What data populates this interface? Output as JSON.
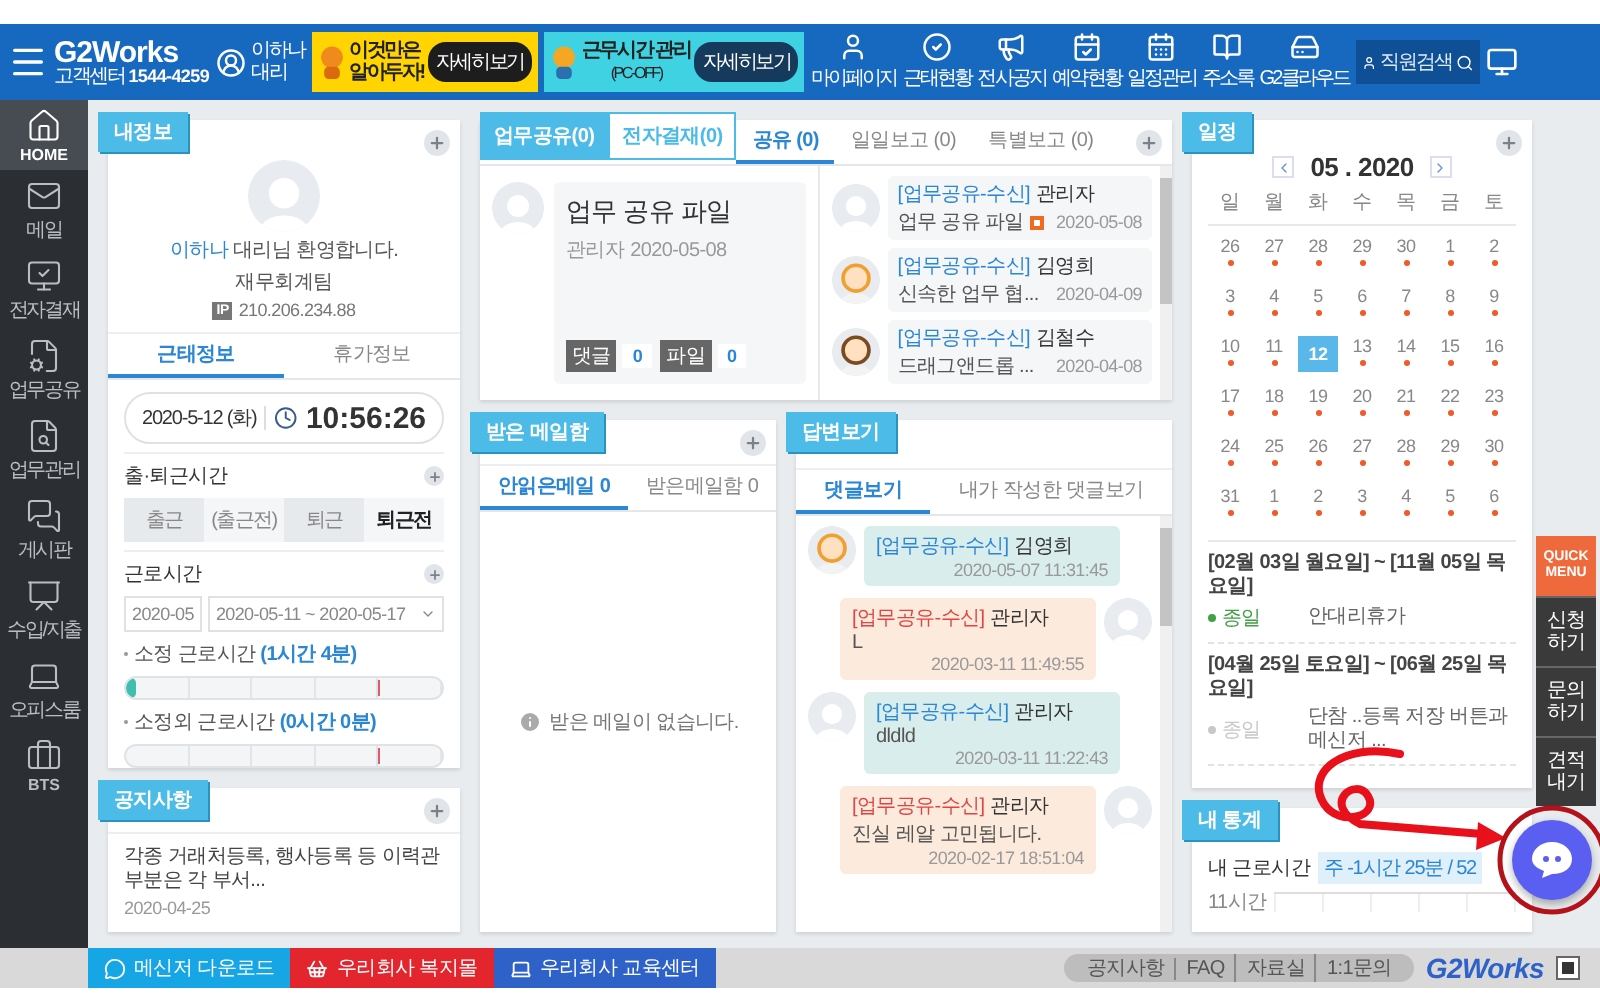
{
  "top_bar": {
    "logo": "G2Works",
    "support_label": "고객센터",
    "support_phone": "1544-4259",
    "user": "이하나 대리",
    "banners": [
      {
        "kind": "tip",
        "text": "이것만은 알아두자!",
        "button": "자세히보기"
      },
      {
        "kind": "pcoff",
        "text": "근무시간 관리",
        "subtext": "(PC-OFF)",
        "button": "자세히보기"
      }
    ],
    "nav": [
      "마이페이지",
      "근태현황",
      "전사공지",
      "예약현황",
      "일정관리",
      "주소록",
      "G2클라우드"
    ],
    "search": {
      "placeholder": "직원검색"
    }
  },
  "sidebar": {
    "items": [
      {
        "label": "HOME",
        "selected": true
      },
      {
        "label": "메일",
        "selected": false
      },
      {
        "label": "전자결재",
        "selected": false
      },
      {
        "label": "업무공유",
        "selected": false
      },
      {
        "label": "업무관리",
        "selected": false
      },
      {
        "label": "게시판",
        "selected": false
      },
      {
        "label": "수입/지출",
        "selected": false
      },
      {
        "label": "오피스룸",
        "selected": false
      },
      {
        "label": "BTS",
        "selected": false
      }
    ]
  },
  "my_info": {
    "title": "내정보",
    "greeting": "**이하나** 대리님 환영합니다.",
    "department": "재무회계팀",
    "ip_label": "IP",
    "ip": "210.206.234.88",
    "tabs": [
      {
        "label": "근태정보",
        "selected": true
      },
      {
        "label": "휴가정보",
        "selected": false
      }
    ],
    "date": "2020-5-12 (화)",
    "time": "10:56:26",
    "commute": {
      "title": "출·퇴근시간",
      "cells": [
        {
          "label": "출근",
          "kind": "label"
        },
        {
          "label": "(출근전)",
          "kind": "value"
        },
        {
          "label": "퇴근",
          "kind": "label"
        },
        {
          "label": "퇴근전",
          "kind": "strong"
        }
      ]
    },
    "work_time": {
      "title": "근로시간",
      "month": "2020-05",
      "week": "2020-05-11 ~ 2020-05-17",
      "bars": [
        {
          "label": "소정 근로시간 **(1시간 4분)**",
          "level": 0.03
        },
        {
          "label": "소정외 근로시간 **(0시간 0분)**"
        }
      ]
    }
  },
  "notice": {
    "title": "공지사항",
    "items": [
      {
        "text": "각종 거래처등록, 행사등록 등 이력관부분은 각 부서...",
        "date": "2020-04-25"
      }
    ]
  },
  "work_share": {
    "tabs": [
      {
        "label": "업무공유(0)",
        "selected": true
      },
      {
        "label": "전자결재(0)",
        "selected": false
      }
    ],
    "subtabs": [
      {
        "label": "공유 (0)",
        "selected": true
      },
      {
        "label": "일일보고 (0)",
        "selected": false
      },
      {
        "label": "특별보고 (0)",
        "selected": false
      }
    ],
    "featured": {
      "title": "업무 공유 파일",
      "author": "관리자",
      "date": "2020-05-08",
      "counts": [
        {
          "label": "댓글",
          "value": "0"
        },
        {
          "label": "파일",
          "value": "0"
        }
      ]
    },
    "feed": [
      {
        "tag": "[업무공유-수신]",
        "name": "관리자",
        "text": "업무 공유 파일",
        "new": true,
        "date": "2020-05-08",
        "avatar": {
          "kind": "blank"
        }
      },
      {
        "tag": "[업무공유-수신]",
        "name": "김영희",
        "text": "신속한 업무 협...",
        "new": false,
        "date": "2020-04-09",
        "avatar": {
          "kind": "girl"
        }
      },
      {
        "tag": "[업무공유-수신]",
        "name": "김철수",
        "text": "드래그앤드롭 ...",
        "new": false,
        "date": "2020-04-08",
        "avatar": {
          "kind": "boy"
        }
      }
    ]
  },
  "mail": {
    "title": "받은 메일함",
    "tabs": [
      {
        "label": "안읽은메일 0",
        "selected": true
      },
      {
        "label": "받은메일함 0",
        "selected": false
      }
    ],
    "empty": "받은 메일이 없습니다."
  },
  "replies": {
    "title": "답변보기",
    "tabs": [
      {
        "label": "댓글보기",
        "selected": true
      },
      {
        "label": "내가 작성한 댓글보기",
        "selected": false
      }
    ],
    "items": [
      {
        "kind": "left",
        "tag": "[업무공유-수신]",
        "name": "김영희",
        "date": "2020-05-07 11:31:45",
        "avatar": {
          "kind": "girl"
        }
      },
      {
        "kind": "right",
        "tag": "[업무공유-수신]",
        "name": "관리자",
        "text": "L",
        "date": "2020-03-11 11:49:55",
        "avatar": {
          "kind": "blank"
        }
      },
      {
        "kind": "left",
        "tag": "[업무공유-수신]",
        "name": "관리자",
        "text": "dldld",
        "date": "2020-03-11 11:22:43",
        "avatar": {
          "kind": "blank"
        }
      },
      {
        "kind": "right",
        "tag": "[업무공유-수신]",
        "name": "관리자",
        "text": "진실 레알 고민됩니다.",
        "date": "2020-02-17 18:51:04",
        "avatar": {
          "kind": "blank"
        }
      }
    ]
  },
  "schedule": {
    "title": "일정",
    "month": "05 . 2020",
    "weekdays": [
      "일",
      "월",
      "화",
      "수",
      "목",
      "금",
      "토"
    ],
    "weeks": [
      [
        {
          "day": "26",
          "selected": false,
          "event": true
        },
        {
          "day": "27",
          "selected": false,
          "event": true
        },
        {
          "day": "28",
          "selected": false,
          "event": true
        },
        {
          "day": "29",
          "selected": false,
          "event": true
        },
        {
          "day": "30",
          "selected": false,
          "event": true
        },
        {
          "day": "1",
          "selected": false,
          "event": true
        },
        {
          "day": "2",
          "selected": false,
          "event": true
        }
      ],
      [
        {
          "day": "3",
          "selected": false,
          "event": true
        },
        {
          "day": "4",
          "selected": false,
          "event": true
        },
        {
          "day": "5",
          "selected": false,
          "event": true
        },
        {
          "day": "6",
          "selected": false,
          "event": true
        },
        {
          "day": "7",
          "selected": false,
          "event": true
        },
        {
          "day": "8",
          "selected": false,
          "event": true
        },
        {
          "day": "9",
          "selected": false,
          "event": true
        }
      ],
      [
        {
          "day": "10",
          "selected": false,
          "event": true
        },
        {
          "day": "11",
          "selected": false,
          "event": true
        },
        {
          "day": "12",
          "selected": true,
          "event": false
        },
        {
          "day": "13",
          "selected": false,
          "event": true
        },
        {
          "day": "14",
          "selected": false,
          "event": true
        },
        {
          "day": "15",
          "selected": false,
          "event": true
        },
        {
          "day": "16",
          "selected": false,
          "event": true
        }
      ],
      [
        {
          "day": "17",
          "selected": false,
          "event": true
        },
        {
          "day": "18",
          "selected": false,
          "event": true
        },
        {
          "day": "19",
          "selected": false,
          "event": true
        },
        {
          "day": "20",
          "selected": false,
          "event": true
        },
        {
          "day": "21",
          "selected": false,
          "event": true
        },
        {
          "day": "22",
          "selected": false,
          "event": true
        },
        {
          "day": "23",
          "selected": false,
          "event": true
        }
      ],
      [
        {
          "day": "24",
          "selected": false,
          "event": true
        },
        {
          "day": "25",
          "selected": false,
          "event": true
        },
        {
          "day": "26",
          "selected": false,
          "event": true
        },
        {
          "day": "27",
          "selected": false,
          "event": true
        },
        {
          "day": "28",
          "selected": false,
          "event": true
        },
        {
          "day": "29",
          "selected": false,
          "event": true
        },
        {
          "day": "30",
          "selected": false,
          "event": true
        }
      ],
      [
        {
          "day": "31",
          "selected": false,
          "event": true
        },
        {
          "day": "1",
          "selected": false,
          "event": true
        },
        {
          "day": "2",
          "selected": false,
          "event": true
        },
        {
          "day": "3",
          "selected": false,
          "event": true
        },
        {
          "day": "4",
          "selected": false,
          "event": true
        },
        {
          "day": "5",
          "selected": false,
          "event": true
        },
        {
          "day": "6",
          "selected": false,
          "event": true
        }
      ]
    ],
    "events": [
      {
        "range": "[02월 03일 월요일] ~ [11월 05일 목요일]",
        "tag": "종일",
        "title": "안대리휴가",
        "color": "#43a047"
      },
      {
        "range": "[04월 25일 토요일] ~ [06월 25일 목요일]",
        "tag": "종일",
        "title": "단참 ..등록 저장 버튼과 메신저 ...",
        "color": "#c8c8c8"
      }
    ]
  },
  "stats": {
    "title": "내 통계",
    "label": "내 근로시간",
    "value": "주 -1시간 25분 / 52",
    "axis_label": "11시간"
  },
  "quick_menu": {
    "title": "QUICK MENU",
    "items": [
      "신청하기",
      "문의하기",
      "견적내기"
    ]
  },
  "bottom_bar": {
    "buttons": [
      {
        "label": "메신저 다운로드",
        "color": "#16a6e6"
      },
      {
        "label": "우리회사 복지몰",
        "color": "#e3262d"
      },
      {
        "label": "우리회사 교육센터",
        "color": "#2e62c9"
      }
    ],
    "links": [
      "공지사항",
      "FAQ",
      "자료실",
      "1:1문의"
    ],
    "brand": "G2Works"
  }
}
